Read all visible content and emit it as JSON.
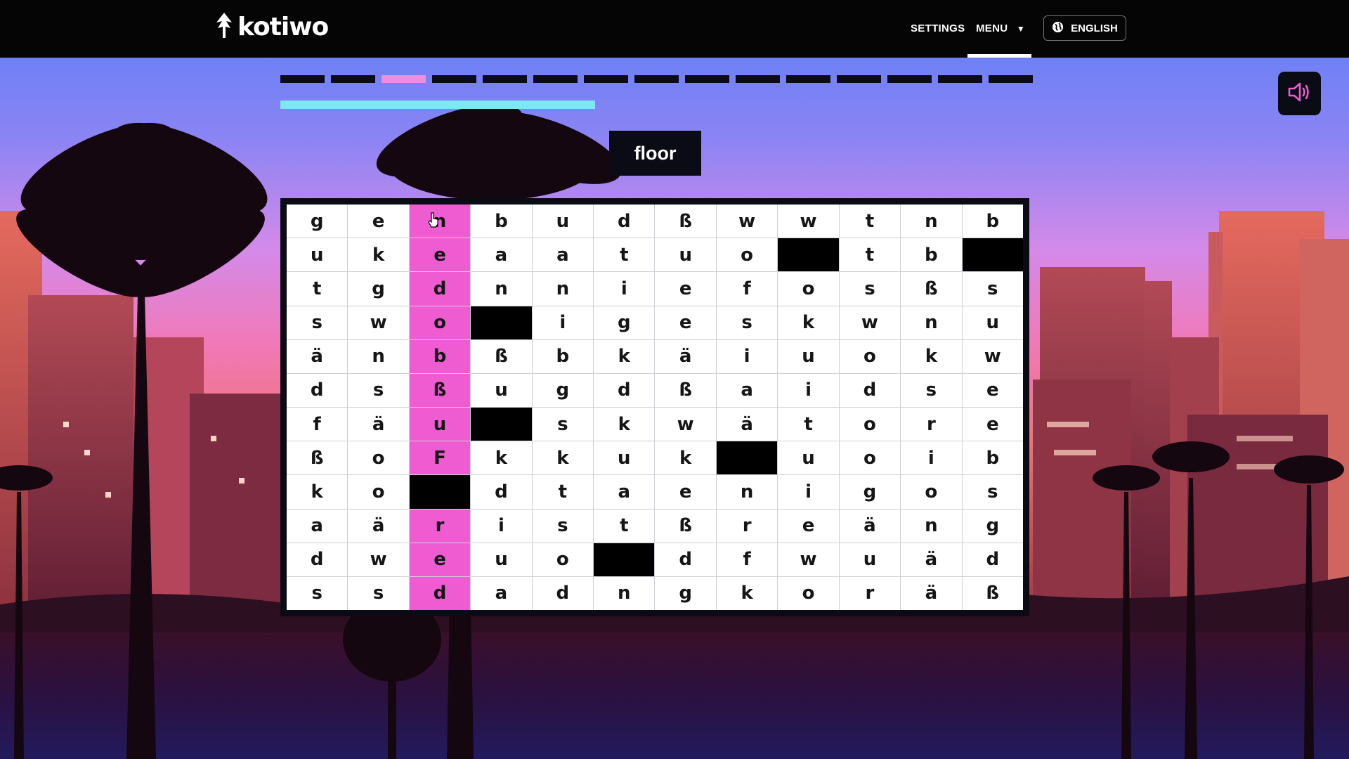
{
  "brand": {
    "name": "kotiwo"
  },
  "nav": {
    "settings_label": "SETTINGS",
    "menu_label": "MENU",
    "menu_icon": "triangle-down-icon",
    "language_label": "ENGLISH",
    "language_icon": "globe-icon"
  },
  "progress": {
    "steps_total": 15,
    "current_step": 3,
    "time_remaining_fraction": 0.42
  },
  "sound": {
    "icon": "speaker-icon"
  },
  "prompt": {
    "word": "floor"
  },
  "puzzle": {
    "rows": [
      [
        "g",
        "e",
        "n",
        "b",
        "u",
        "d",
        "ß",
        "w",
        "w",
        "t",
        "n",
        "b"
      ],
      [
        "u",
        "k",
        "e",
        "a",
        "a",
        "t",
        "u",
        "o",
        "",
        "t",
        "b",
        ""
      ],
      [
        "t",
        "g",
        "d",
        "n",
        "n",
        "i",
        "e",
        "f",
        "o",
        "s",
        "ß",
        "s"
      ],
      [
        "s",
        "w",
        "o",
        "",
        "i",
        "g",
        "e",
        "s",
        "k",
        "w",
        "n",
        "u"
      ],
      [
        "ä",
        "n",
        "b",
        "ß",
        "b",
        "k",
        "ä",
        "i",
        "u",
        "o",
        "k",
        "w"
      ],
      [
        "d",
        "s",
        "ß",
        "u",
        "g",
        "d",
        "ß",
        "a",
        "i",
        "d",
        "s",
        "e"
      ],
      [
        "f",
        "ä",
        "u",
        "",
        "s",
        "k",
        "w",
        "ä",
        "t",
        "o",
        "r",
        "e"
      ],
      [
        "ß",
        "o",
        "F",
        "k",
        "k",
        "u",
        "k",
        "",
        "u",
        "o",
        "i",
        "b"
      ],
      [
        "k",
        "o",
        "",
        "d",
        "t",
        "a",
        "e",
        "n",
        "i",
        "g",
        "o",
        "s"
      ],
      [
        "a",
        "ä",
        "r",
        "i",
        "s",
        "t",
        "ß",
        "r",
        "e",
        "ä",
        "n",
        "g"
      ],
      [
        "d",
        "w",
        "e",
        "u",
        "o",
        "",
        "d",
        "f",
        "w",
        "u",
        "ä",
        "d"
      ],
      [
        "s",
        "s",
        "d",
        "a",
        "d",
        "n",
        "g",
        "k",
        "o",
        "r",
        "ä",
        "ß"
      ]
    ],
    "highlighted_column": 3
  },
  "colors": {
    "highlight": "#ef5cd2",
    "active_step": "#ee8ee0",
    "timer": "#7de8f2",
    "panel": "#0b0b16"
  }
}
